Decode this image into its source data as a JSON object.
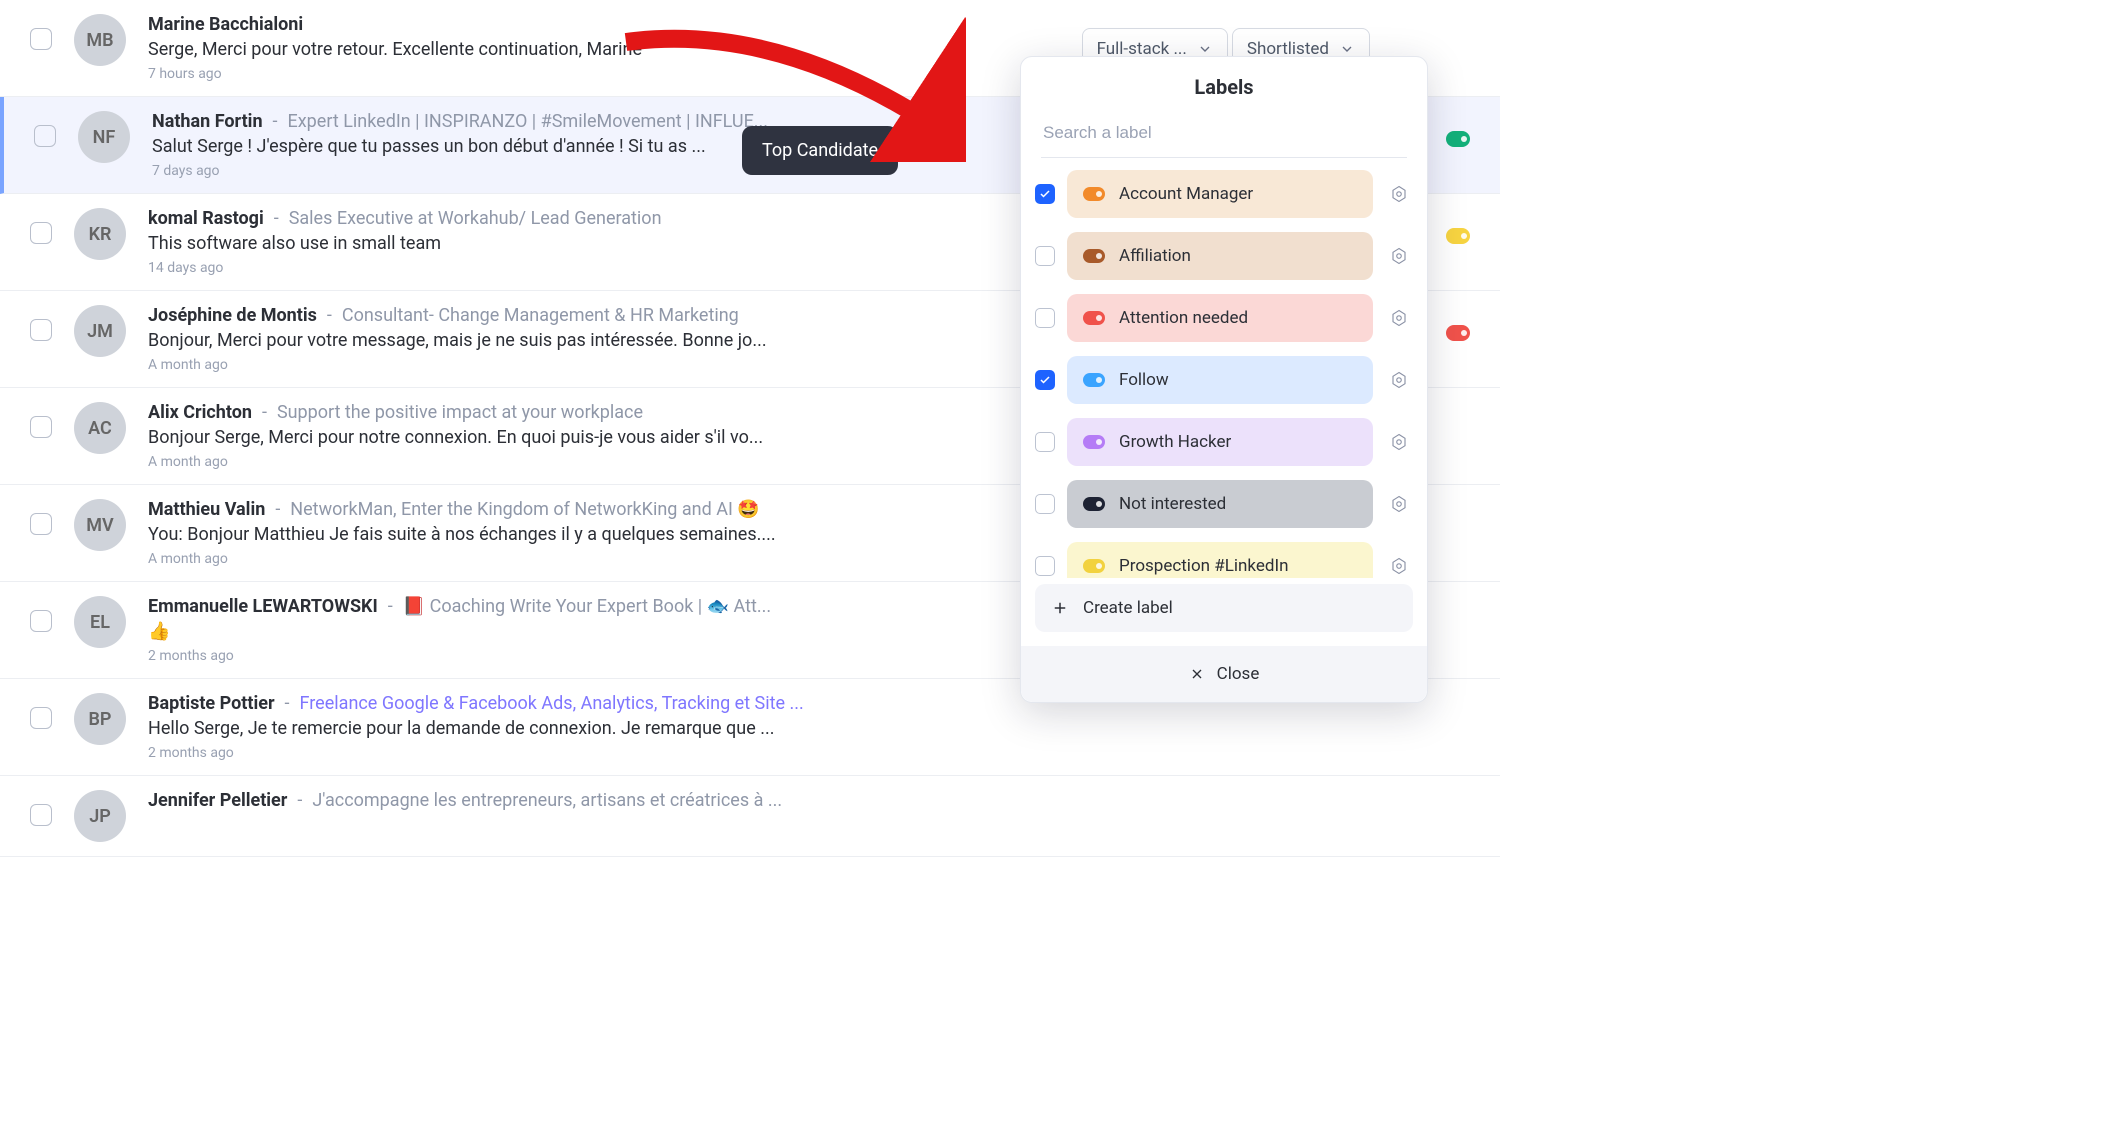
{
  "dropdowns": {
    "campaign": "Full-stack ...",
    "stage": "Shortlisted"
  },
  "tooltip": "Top Candidate",
  "conversations": [
    {
      "name": "Marine Bacchialoni",
      "headline": "",
      "link": false,
      "preview": "Serge, Merci pour votre retour. Excellente continuation, Marine",
      "time": "7 hours ago",
      "chips": [],
      "selected": false
    },
    {
      "name": "Nathan Fortin",
      "headline": "Expert LinkedIn | INSPIRANZO | #SmileMovement | INFLUE...",
      "link": false,
      "preview": "Salut Serge ! J'espère que tu passes un bon début d'année ! Si tu as ...",
      "time": "7 days ago",
      "chips": [
        "#13b07a"
      ],
      "selected": true
    },
    {
      "name": "komal Rastogi",
      "headline": "Sales Executive at Workahub/ Lead Generation",
      "link": false,
      "preview": "This software also use in small team",
      "time": "14 days ago",
      "chips": [
        "#f7d441"
      ],
      "selected": false
    },
    {
      "name": "Joséphine de Montis",
      "headline": "Consultant- Change Management & HR Marketing",
      "link": false,
      "preview": "Bonjour, Merci pour votre message, mais je ne suis pas intéressée. Bonne jo...",
      "time": "A month ago",
      "chips": [
        "#f0524b"
      ],
      "selected": false
    },
    {
      "name": "Alix Crichton",
      "headline": "Support the positive impact at your workplace",
      "link": false,
      "preview": "Bonjour Serge, Merci pour notre connexion. En quoi puis-je vous aider s'il vo...",
      "time": "A month ago",
      "chips": [],
      "selected": false
    },
    {
      "name": "Matthieu Valin",
      "headline": "NetworkMan, Enter the Kingdom of NetworkKing and AI 🤩",
      "link": false,
      "preview": "You: Bonjour Matthieu Je fais suite à nos échanges il y a quelques semaines....",
      "time": "A month ago",
      "chips": [],
      "selected": false
    },
    {
      "name": "Emmanuelle LEWARTOWSKI",
      "headline": "📕 Coaching Write Your Expert Book | 🐟 Att...",
      "link": false,
      "preview": "👍",
      "time": "2 months ago",
      "chips": [],
      "selected": false
    },
    {
      "name": "Baptiste Pottier",
      "headline": "Freelance Google & Facebook Ads, Analytics, Tracking et Site ...",
      "link": true,
      "preview": "Hello Serge, Je te remercie pour la demande de connexion. Je remarque que ...",
      "time": "2 months ago",
      "chips": [],
      "selected": false
    },
    {
      "name": "Jennifer Pelletier",
      "headline": "J'accompagne les entrepreneurs, artisans et créatrices à ...",
      "link": false,
      "preview": "",
      "time": "",
      "chips": [],
      "selected": false
    }
  ],
  "panel": {
    "title": "Labels",
    "search_placeholder": "Search a label",
    "labels": [
      {
        "checked": true,
        "text": "Account Manager",
        "pill_bg": "#f8e8d6",
        "dot": "#f28a2a"
      },
      {
        "checked": false,
        "text": "Affiliation",
        "pill_bg": "#f1dfcf",
        "dot": "#a85a2a"
      },
      {
        "checked": false,
        "text": "Attention needed",
        "pill_bg": "#fbd8d6",
        "dot": "#f0524b"
      },
      {
        "checked": true,
        "text": "Follow",
        "pill_bg": "#dceaff",
        "dot": "#3aa4ff"
      },
      {
        "checked": false,
        "text": "Growth Hacker",
        "pill_bg": "#ece1fb",
        "dot": "#b57cf6"
      },
      {
        "checked": false,
        "text": "Not interested",
        "pill_bg": "#c9ccd2",
        "dot": "#1d2233"
      },
      {
        "checked": false,
        "text": "Prospection #LinkedIn",
        "pill_bg": "#fbf6cf",
        "dot": "#f2d23f"
      }
    ],
    "create": "Create label",
    "close": "Close"
  },
  "avatars": [
    "MB",
    "NF",
    "KR",
    "JM",
    "AC",
    "MV",
    "EL",
    "BP",
    "JP"
  ]
}
